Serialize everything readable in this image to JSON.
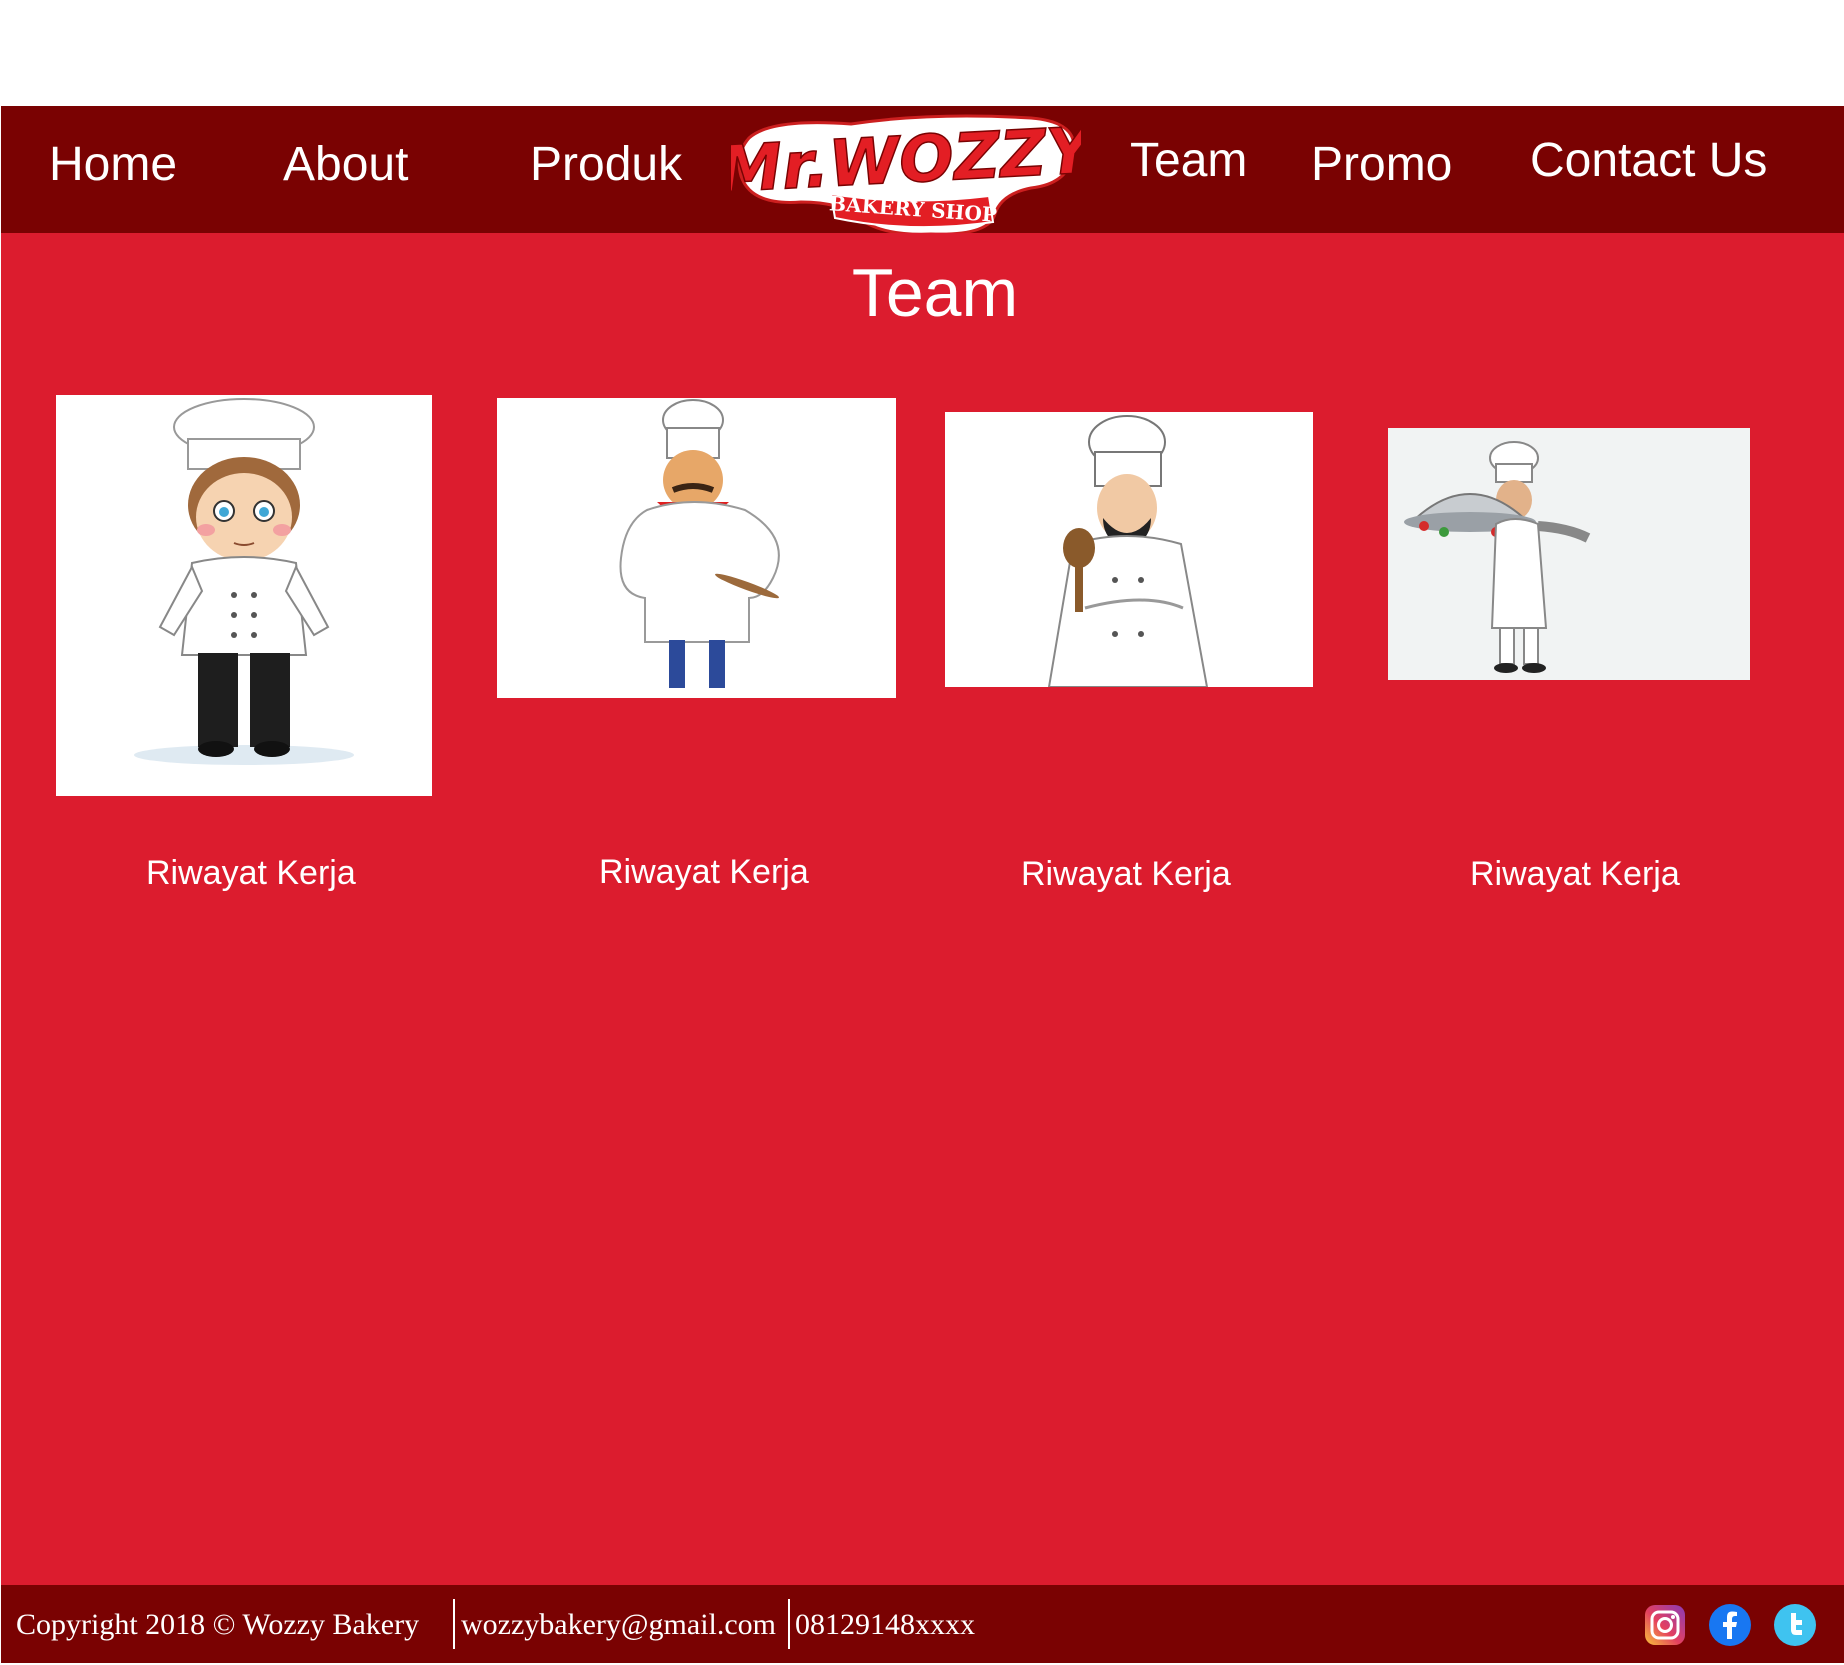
{
  "nav": {
    "items": [
      {
        "label": "Home"
      },
      {
        "label": "About"
      },
      {
        "label": "Produk"
      },
      {
        "label": "Team"
      },
      {
        "label": "Promo"
      },
      {
        "label": "Contact Us"
      }
    ],
    "logo": {
      "brand": "Mr.WOZZY",
      "tagline": "BAKERY SHOP"
    }
  },
  "main": {
    "title": "Team",
    "members": [
      {
        "image": "chef-boy-image",
        "link_label": "Riwayat Kerja"
      },
      {
        "image": "chef-mustache-image",
        "link_label": "Riwayat Kerja"
      },
      {
        "image": "chef-spoon-image",
        "link_label": "Riwayat Kerja"
      },
      {
        "image": "chef-platter-image",
        "link_label": "Riwayat Kerja"
      }
    ]
  },
  "footer": {
    "copyright": "Copyright 2018 ©  Wozzy Bakery",
    "email": "wozzybakery@gmail.com",
    "phone": "08129148xxxx",
    "social": [
      "instagram-icon",
      "facebook-icon",
      "twitter-icon"
    ]
  },
  "colors": {
    "nav_bg": "#7a0202",
    "main_bg": "#dc1c2e",
    "text": "#ffffff"
  }
}
